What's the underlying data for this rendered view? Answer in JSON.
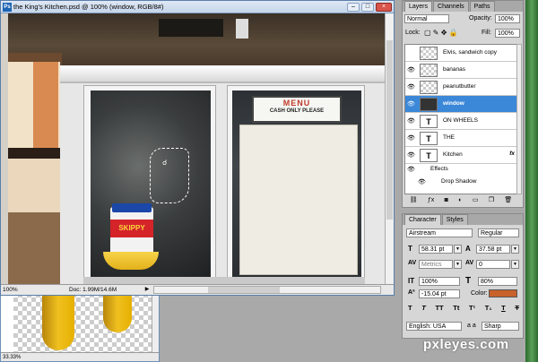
{
  "document": {
    "title": "the King's Kitchen.psd @ 100% (window, RGB/8#)",
    "app_icon_label": "Ps",
    "zoom": "100%",
    "doc_info": "Doc: 1.99M/14.6M",
    "back_zoom": "33.33%"
  },
  "canvas": {
    "menu_title": "MENU",
    "menu_subtitle": "CASH ONLY PLEASE",
    "jar_label": "SKIPPY"
  },
  "layers_panel": {
    "tabs": [
      "Layers",
      "Channels",
      "Paths"
    ],
    "blend_mode": "Normal",
    "opacity_label": "Opacity:",
    "opacity_value": "100%",
    "lock_label": "Lock:",
    "fill_label": "Fill:",
    "fill_value": "100%",
    "layers": [
      {
        "name": "Elvis, sandwich copy",
        "thumb": "",
        "visible": false
      },
      {
        "name": "bananas",
        "thumb": "",
        "visible": true
      },
      {
        "name": "peanutbutter",
        "thumb": "",
        "visible": true
      },
      {
        "name": "window",
        "thumb": "",
        "visible": true,
        "selected": true
      },
      {
        "name": "ON WHEELS",
        "thumb": "T",
        "visible": true
      },
      {
        "name": "THE",
        "thumb": "T",
        "visible": true
      },
      {
        "name": "Kitchen",
        "thumb": "T",
        "visible": true,
        "fx": "fx"
      },
      {
        "name": "Effects",
        "sub": true
      },
      {
        "name": "Drop Shadow",
        "sub2": true
      }
    ]
  },
  "character_panel": {
    "tabs": [
      "Character",
      "Styles"
    ],
    "font_family": "Airstream",
    "font_style": "Regular",
    "font_size": "58.31 pt",
    "leading": "37.58 pt",
    "kerning": "Metrics",
    "tracking": "0",
    "vertical_scale": "100%",
    "horizontal_scale": "80%",
    "baseline_shift": "-15.04 pt",
    "color_label": "Color:",
    "color_value": "#c8622a",
    "format_buttons": [
      "T",
      "T",
      "TT",
      "Tt",
      "T¹",
      "T₁",
      "T",
      "T"
    ],
    "language": "English: USA",
    "aa_label": "a a",
    "antialias": "Sharp"
  },
  "watermark": "pxleyes.com"
}
